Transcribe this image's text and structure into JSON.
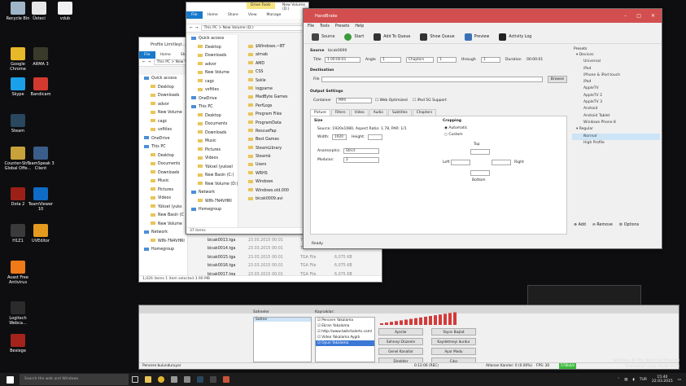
{
  "desktop": {
    "icons": [
      {
        "label": "Recycle Bin",
        "color": "#9fb6c8"
      },
      {
        "label": "Üsteci",
        "color": "#e6e6e6"
      },
      {
        "label": "vdub",
        "color": "#f0f0f0"
      },
      {
        "label": "Google Chrome",
        "color": "#e7b928"
      },
      {
        "label": "ARMA 3",
        "color": "#3a3a2a"
      },
      {
        "label": "Skype",
        "color": "#1aa0e8"
      },
      {
        "label": "Bandicam",
        "color": "#d33a2f"
      },
      {
        "label": "Steam",
        "color": "#29475e"
      },
      {
        "label": "Counter-Str... Global Offe...",
        "color": "#c9a13a"
      },
      {
        "label": "TeamSpeak 3 Client",
        "color": "#3a5d8a"
      },
      {
        "label": "Dota 2",
        "color": "#9c2018"
      },
      {
        "label": "TeamViewer 10",
        "color": "#0e6cc6"
      },
      {
        "label": "H1Z1",
        "color": "#3a3a3a"
      },
      {
        "label": "UVEditor",
        "color": "#e39a1e"
      },
      {
        "label": "Avast Free Antivirus",
        "color": "#f07a18"
      },
      {
        "label": "Logitech Webca...",
        "color": "#2b2b2b"
      },
      {
        "label": "Besiege",
        "color": "#a4241d"
      }
    ]
  },
  "explorer_back": {
    "title": "Profile Limitleşt...",
    "ribbon": [
      "File",
      "Home",
      "Share",
      "View"
    ],
    "address": "This PC > New Volume (D:)",
    "nav": [
      "Quick access",
      "Desktop",
      "Downloads",
      "advor",
      "New Volume",
      "cagc",
      "vsftiles",
      "OneDrive",
      "This PC",
      "Desktop",
      "Documents",
      "Downloads",
      "Music",
      "Pictures",
      "Videos",
      "Yüksel (yuks",
      "New Basin (C",
      "New Volume",
      "Network",
      "WIN-7N4VHRI",
      "Homegroup"
    ],
    "status": "1,026 items     1 item selected  3.90 MB",
    "files": [
      {
        "name": "bicak0013.tga",
        "date": "23.03.2015 00:01",
        "type": "TGA File",
        "size": "6,075 KB"
      },
      {
        "name": "bicak0014.tga",
        "date": "23.03.2015 00:01",
        "type": "TGA File",
        "size": "6,075 KB"
      },
      {
        "name": "bicak0015.tga",
        "date": "23.03.2015 00:01",
        "type": "TGA File",
        "size": "6,075 KB"
      },
      {
        "name": "bicak0016.tga",
        "date": "23.03.2015 00:01",
        "type": "TGA File",
        "size": "6,075 KB"
      },
      {
        "name": "bicak0017.tga",
        "date": "23.03.2015 00:01",
        "type": "TGA File",
        "size": "6,075 KB"
      }
    ]
  },
  "explorer_front": {
    "title": "New Volume (D:)",
    "tool_tab": "Drive Tools",
    "manage": "Manage",
    "ribbon": [
      "File",
      "Home",
      "Share",
      "View"
    ],
    "address": "This PC > New Volume (D:)",
    "nav": [
      "Quick access",
      "Desktop",
      "Downloads",
      "advor",
      "New Volume",
      "cagc",
      "vsftiles",
      "OneDrive",
      "This PC",
      "Desktop",
      "Documents",
      "Downloads",
      "Music",
      "Pictures",
      "Videos",
      "Yüksel (yuksel",
      "New Basin (C:)",
      "New Volume (D:)",
      "Network",
      "WIN-7N4VHRI",
      "Homegroup"
    ],
    "files": [
      "$Windows.~BT",
      "almab",
      "AMD",
      "CSS",
      "Sskle",
      "logpame",
      "MadByte Games",
      "PerfLogs",
      "Program Files",
      "ProgramData",
      "RescueFap",
      "Best Games",
      "SteamLibrary",
      "Steamb",
      "Users",
      "WRHS",
      "Windows",
      "Windows.old.000",
      "bicak0009.avi"
    ],
    "status": "37 items"
  },
  "handbrake": {
    "title": "HandBrake",
    "menu": [
      "File",
      "Tools",
      "Presets",
      "Help"
    ],
    "toolbar": [
      "Source",
      "Start",
      "Add To Queue",
      "Show Queue",
      "Preview",
      "Activity Log"
    ],
    "source_label": "Source",
    "source_value": "bicak0000",
    "title_label": "Title",
    "title_value": "1 00:00:01",
    "angle_label": "Angle",
    "angle_value": "1",
    "chapters_value": "Chapters",
    "ch_from": "1",
    "through_label": "through",
    "ch_to": "1",
    "duration_label": "Duration",
    "duration_value": "00:00:01",
    "destination_label": "Destination",
    "file_label": "File",
    "browse": "Browse",
    "output_label": "Output Settings",
    "container_label": "Container",
    "container_value": "MP4",
    "web_optimized": "Web Optimized",
    "ipod": "iPod 5G Support",
    "tabs": [
      "Picture",
      "Filters",
      "Video",
      "Audio",
      "Subtitles",
      "Chapters"
    ],
    "size_label": "Size",
    "source_info": "Source:  1920x1080, Aspect Ratio: 1.78, PAR: 1/1",
    "width_label": "Width:",
    "width_value": "1920",
    "height_label": "Height:",
    "anamorphic_label": "Anamorphic:",
    "anamorphic_value": "Strict",
    "modulus_label": "Modulus:",
    "modulus_value": "2",
    "cropping_label": "Cropping",
    "crop_auto": "Automatic",
    "crop_custom": "Custom",
    "top": "Top",
    "left": "Left",
    "right": "Right",
    "bottom": "Bottom",
    "status": "Ready",
    "presets_title": "Presets",
    "presets": [
      {
        "label": "Devices",
        "grp": true
      },
      {
        "label": "Universal"
      },
      {
        "label": "iPod"
      },
      {
        "label": "iPhone & iPod touch"
      },
      {
        "label": "iPad"
      },
      {
        "label": "AppleTV"
      },
      {
        "label": "AppleTV 2"
      },
      {
        "label": "AppleTV 3"
      },
      {
        "label": "Android"
      },
      {
        "label": "Android Tablet"
      },
      {
        "label": "Windows Phone 8"
      },
      {
        "label": "Regular",
        "grp": true
      },
      {
        "label": "Normal",
        "sel": true
      },
      {
        "label": "High Profile"
      }
    ],
    "add": "Add",
    "remove": "Remove",
    "options": "Options"
  },
  "recorder": {
    "sources_label": "Sahneler",
    "sources_selected": "Sahne",
    "items_label": "Kaynaklar:",
    "items": [
      "Pencere Yakalama",
      "Ekran Yakalama",
      "http://www.twitchalerts.com/",
      "Video Yakalama Aygıtı",
      "Oyun Yakalama"
    ],
    "buttons": [
      "Ayarlar",
      "Yayını Başlat",
      "Sahneyi Düzenle",
      "Kaydetmeyi durdur",
      "Genel Kanallar",
      "Ayar Modu",
      "Direktler",
      "Çıkış"
    ],
    "status_left": "Pencere bulunduruyor",
    "time": "0:12:06 (REC)",
    "dropped": "Atlanan Kareler: 0 (0.00%)",
    "fps": "FPS: 30",
    "bitrate": "578kb/s"
  },
  "watermark": {
    "line1": "Windows 10 Pro Technical Preview",
    "line2": "Evaluation copy. Build 9926"
  },
  "taskbar": {
    "search_placeholder": "Search the web and Windows",
    "lang": "TUR",
    "time": "15:40",
    "date": "22.03.2015"
  }
}
